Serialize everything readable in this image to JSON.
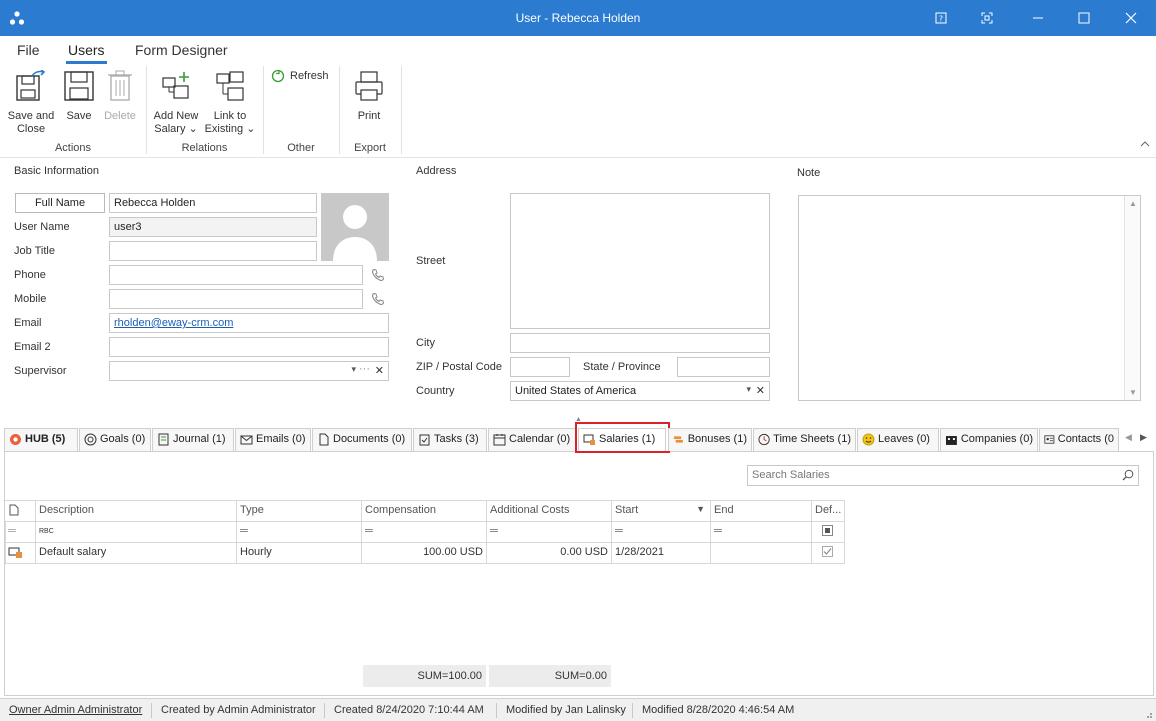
{
  "window": {
    "title": "User - Rebecca Holden"
  },
  "menu": {
    "file": "File",
    "users": "Users",
    "form_designer": "Form Designer"
  },
  "ribbon": {
    "save_close": [
      "Save and",
      "Close"
    ],
    "save": "Save",
    "delete": "Delete",
    "add_new_salary": [
      "Add New",
      "Salary"
    ],
    "link_existing": [
      "Link to",
      "Existing"
    ],
    "refresh": "Refresh",
    "print": "Print",
    "groups": {
      "actions": "Actions",
      "relations": "Relations",
      "other": "Other",
      "export": "Export"
    }
  },
  "basic": {
    "section": "Basic Information",
    "full_name_label": "Full Name",
    "full_name": "Rebecca Holden",
    "user_name_label": "User Name",
    "user_name": "user3",
    "job_title_label": "Job Title",
    "job_title": "",
    "phone_label": "Phone",
    "phone": "",
    "mobile_label": "Mobile",
    "mobile": "",
    "email_label": "Email",
    "email": "rholden@eway-crm.com",
    "email2_label": "Email 2",
    "email2": "",
    "supervisor_label": "Supervisor",
    "supervisor": ""
  },
  "address": {
    "section": "Address",
    "street_label": "Street",
    "street": "",
    "city_label": "City",
    "city": "",
    "zip_label": "ZIP / Postal Code",
    "zip": "",
    "state_label": "State / Province",
    "state": "",
    "country_label": "Country",
    "country": "United States of America"
  },
  "note": {
    "section": "Note",
    "text": ""
  },
  "tabs": [
    {
      "label": "HUB (5)",
      "icon": "hub-icon"
    },
    {
      "label": "Goals (0)",
      "icon": "goals-icon"
    },
    {
      "label": "Journal (1)",
      "icon": "journal-icon"
    },
    {
      "label": "Emails (0)",
      "icon": "email-icon"
    },
    {
      "label": "Documents (0)",
      "icon": "document-icon"
    },
    {
      "label": "Tasks (3)",
      "icon": "tasks-icon"
    },
    {
      "label": "Calendar (0)",
      "icon": "calendar-icon"
    },
    {
      "label": "Salaries (1)",
      "icon": "salaries-icon"
    },
    {
      "label": "Bonuses (1)",
      "icon": "bonuses-icon"
    },
    {
      "label": "Time Sheets (1)",
      "icon": "timesheets-icon"
    },
    {
      "label": "Leaves (0)",
      "icon": "leaves-icon"
    },
    {
      "label": "Companies (0)",
      "icon": "companies-icon"
    },
    {
      "label": "Contacts (0",
      "icon": "contacts-icon"
    }
  ],
  "salaries": {
    "search_placeholder": "Search Salaries",
    "columns": [
      "Description",
      "Type",
      "Compensation",
      "Additional Costs",
      "Start",
      "End",
      "Def..."
    ],
    "filter_text_icon": "RBC",
    "rows": [
      {
        "description": "Default salary",
        "type": "Hourly",
        "compensation": "100.00 USD",
        "additional_costs": "0.00 USD",
        "start": "1/28/2021",
        "end": "",
        "default": true
      }
    ],
    "sum_compensation": "SUM=100.00",
    "sum_additional": "SUM=0.00"
  },
  "status": {
    "owner": "Owner Admin Administrator",
    "created_by": "Created by Admin Administrator",
    "created": "Created 8/24/2020 7:10:44 AM",
    "modified_by": "Modified by Jan Lalinsky",
    "modified": "Modified 8/28/2020 4:46:54 AM"
  },
  "colors": {
    "titlebar": "#2b7bd1",
    "highlight": "#d9222a",
    "link": "#1a5fb4"
  }
}
